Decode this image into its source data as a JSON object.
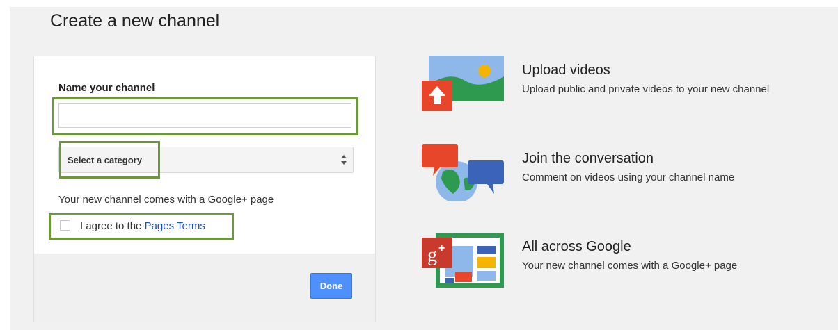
{
  "page": {
    "title": "Create a new channel"
  },
  "form": {
    "name_label": "Name your channel",
    "name_value": "",
    "name_placeholder": "",
    "category_selected": "Select a category",
    "googleplus_note": "Your new channel comes with a Google+ page",
    "agree_prefix": "I agree to the ",
    "agree_link": "Pages Terms",
    "agree_checked": false,
    "done_label": "Done"
  },
  "features": [
    {
      "icon": "upload-videos-icon",
      "title": "Upload videos",
      "description": "Upload public and private videos to your new channel"
    },
    {
      "icon": "conversation-icon",
      "title": "Join the conversation",
      "description": "Comment on videos using your channel name"
    },
    {
      "icon": "google-plus-icon",
      "title": "All across Google",
      "description": "Your new channel comes with a Google+ page"
    }
  ],
  "colors": {
    "highlight": "#6a9a3a",
    "done_button": "#4d90fe",
    "link": "#1a4fc8",
    "youtube_red": "#e8462a",
    "google_green": "#2e9a4f",
    "google_blue": "#3b63b8"
  }
}
